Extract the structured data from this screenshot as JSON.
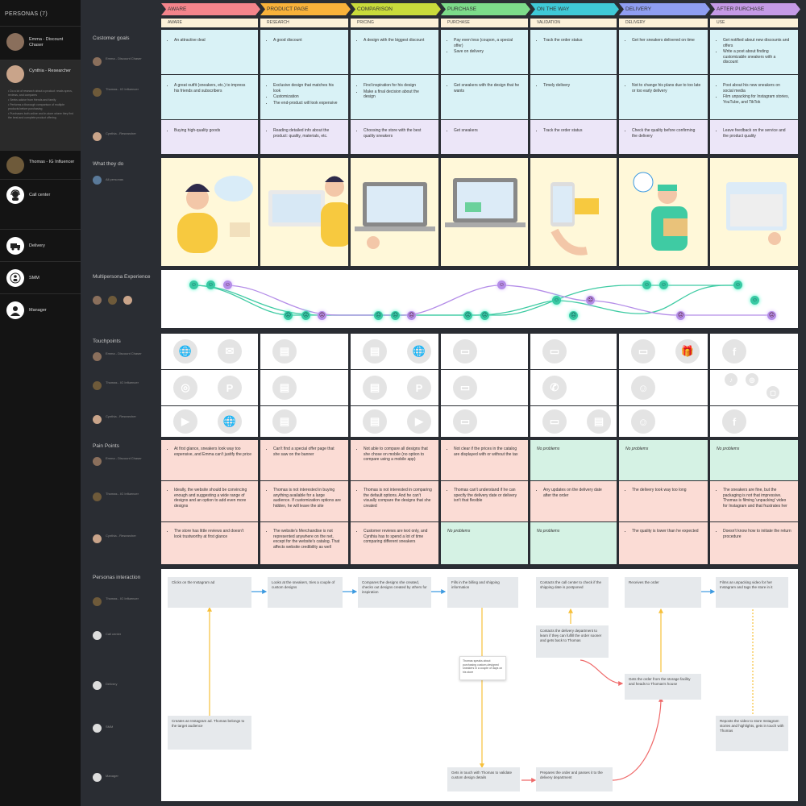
{
  "sidebar": {
    "title": "PERSONAS (7)",
    "personas": [
      {
        "name": "Emma - Discount Chaser",
        "color": "#8a6f5c"
      },
      {
        "name": "Cynthia - Researcher",
        "color": "#c9a48a"
      },
      {
        "name": "Thomas - IG Influencer",
        "color": "#6e5a3a"
      }
    ],
    "cynthia_desc": [
      "• Do a lot of research about a product: reads specs, reviews, and compares",
      "• Seeks advice from friends and family",
      "• Performs a thorough comparison of multiple products before purchasing",
      "• Purchases both online and in-store where they find the best and complete product offering"
    ],
    "roles": [
      {
        "name": "Call center"
      },
      {
        "name": "Delivery"
      },
      {
        "name": "SMM"
      },
      {
        "name": "Manager"
      }
    ]
  },
  "labels": {
    "customer_goals": "Customer goals",
    "what_they_do": "What they do",
    "multipersona": "Multipersona Experience",
    "touchpoints": "Touchpoints",
    "pain_points": "Pain Points",
    "personas_interaction": "Personas interaction",
    "emma": "Emma - Discount Chaser",
    "thomas": "Thomas - IG Influencer",
    "cynthia": "Cynthia - Researcher",
    "all_personas": "All personas",
    "call_center": "Call center",
    "delivery": "Delivery",
    "smm": "SMM",
    "manager": "Manager"
  },
  "phases": [
    {
      "label": "AWARE",
      "color": "#f4848b"
    },
    {
      "label": "PRODUCT PAGE",
      "color": "#f9b23a"
    },
    {
      "label": "COMPARISON",
      "color": "#c9db3b"
    },
    {
      "label": "PURCHASE",
      "color": "#7ddc8a"
    },
    {
      "label": "ON THE WAY",
      "color": "#3fc9d7"
    },
    {
      "label": "DELIVERY",
      "color": "#8f9ef2"
    },
    {
      "label": "AFTER PURCHASE",
      "color": "#c59ae6"
    }
  ],
  "sub_phases": [
    "AWARE",
    "RESEARCH",
    "PRICING",
    "PURCHASE",
    "VALIDATION",
    "DELIVERY",
    "USE"
  ],
  "goals": {
    "emma": [
      [
        "An attractive deal"
      ],
      [
        "A good discount"
      ],
      [
        "A design with the biggest discount"
      ],
      [
        "Pay even less (coupon, a special offer)",
        "Save on delivery"
      ],
      [
        "Track the order status"
      ],
      [
        "Get her sneakers delivered on time"
      ],
      [
        "Get notified about new discounts and offers",
        "Write a post about finding customizable sneakers with a discount"
      ]
    ],
    "thomas": [
      [
        "A great outfit (sneakers, etc.) to impress his friends and subscribers"
      ],
      [
        "Exclusive design that matches his look",
        "Customization",
        "The end-product will look expensive"
      ],
      [
        "Find inspiration for his design",
        "Make a final decision about the design"
      ],
      [
        "Get sneakers with the design that he wants"
      ],
      [
        "Timely delivery"
      ],
      [
        "Not to change his plans due to too late or too early delivery"
      ],
      [
        "Post about his new sneakers on social media",
        "Film unpacking for Instagram stories, YouTube, and TikTok"
      ]
    ],
    "cynthia": [
      [
        "Buying high-quality goods"
      ],
      [
        "Reading detailed info about the product: quality, materials, etc."
      ],
      [
        "Choosing the store with the best quality sneakers"
      ],
      [
        "Get sneakers"
      ],
      [
        "Track the order status"
      ],
      [
        "Check the quality before confirming the delivery"
      ],
      [
        "Leave feedback on the service and the product quality"
      ]
    ]
  },
  "pain_points": {
    "emma": [
      "At first glance, sneakers look way too expensive, and Emma can't justify the price",
      "Can't find a special offer page that she saw on the banner",
      "Not able to compare all designs that she chose on mobile (no option to compare using a mobile app)",
      "Not clear if the prices in the catalog are displayed with or without the tax",
      "No problems",
      "No problems",
      "No problems"
    ],
    "thomas": [
      "Ideally, the website should be convincing enough and suggesting a wide range of designs and an option to add even more designs",
      "Thomas is not interested in buying anything available for a large audience. If customization options are hidden, he will leave the site",
      "Thomas is not interested in comparing the default options. And he can't visually compare the designs that she created",
      "Thomas can't understand if he can specify the delivery date or delivery isn't that flexible",
      "Any updates on the delivery date after the order",
      "The delivery took way too long",
      "The sneakers are fine, but the packaging is not that impressive. Thomas is filming 'unpacking' video for Instagram and that frustrates her"
    ],
    "cynthia": [
      "The store has little reviews and doesn't look trustworthy at first glance",
      "The website's Merchandise is not represented anywhere on the net, except for the website's catalog. That affects website credibility as well",
      "Customer reviews are text only, and Cynthia has to spend a lot of time comparing different sneakers",
      "No problems",
      "No problems",
      "The quality is lower than he expected",
      "Doesn't know how to initiate the return procedure"
    ]
  },
  "interaction": {
    "n1": "Clicks on the Instagram ad",
    "n2": "Looks at the sneakers, tries a couple of custom designs",
    "n3": "Compares the designs she created, checks out designs created by others for inspiration",
    "n4": "Fills in the billing and shipping information",
    "n5": "Contacts the call center to check if the shipping date is postponed",
    "n6": "Receives the order",
    "n7": "Films an unpacking video for her Instagram and tags the store in it",
    "n8": "Contacts the delivery department to learn if they can fulfill the order sooner and gets back to Thomas",
    "n9": "Gets the order from the storage facility and heads to Thomas's house",
    "n10": "Creates an Instagram ad. Thomas belongs to the target audience",
    "n11": "Reposts the video to store Instagram stories and highlights, gets in touch with Thomas",
    "n12": "Gets in touch with Thomas to validate custom design details",
    "n13": "Prepares the order and passes it to the delivery department",
    "mini": "Thomas speaks about purchasing custom-designed sneakers in a couple of days on his store"
  },
  "colors": {
    "arrow_blue": "#3d9ae0",
    "arrow_yellow": "#f7c03a",
    "arrow_red": "#ef6a6a",
    "line_green": "#3fcba3",
    "line_purple": "#b48de8"
  }
}
